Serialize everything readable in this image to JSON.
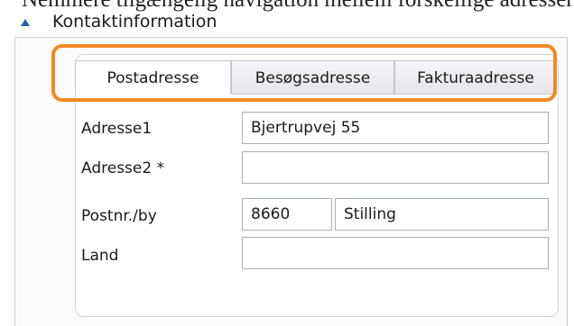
{
  "caption": "Nemmere tilgængelig navigation mellem forskellige adresser",
  "section": {
    "title": "Kontaktinformation"
  },
  "tabs": [
    {
      "label": "Postadresse",
      "active": true
    },
    {
      "label": "Besøgsadresse",
      "active": false
    },
    {
      "label": "Fakturaadresse",
      "active": false
    }
  ],
  "form": {
    "address1": {
      "label": "Adresse1",
      "value": "Bjertrupvej 55"
    },
    "address2": {
      "label": "Adresse2 *",
      "value": ""
    },
    "postal": {
      "label": "Postnr./by",
      "code": "8660",
      "city": "Stilling"
    },
    "country": {
      "label": "Land",
      "value": ""
    }
  },
  "colors": {
    "highlight": "#f08a24",
    "collapse_icon": "#2b5ea8"
  }
}
